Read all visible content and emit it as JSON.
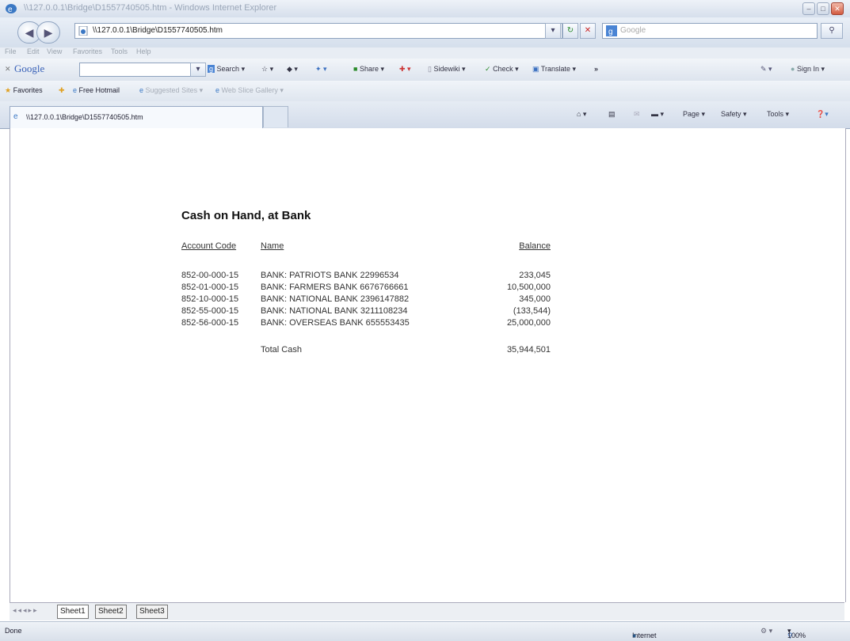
{
  "window": {
    "title": "\\\\127.0.0.1\\Bridge\\D1557740505.htm - Windows Internet Explorer"
  },
  "address": {
    "url": "\\\\127.0.0.1\\Bridge\\D1557740505.htm",
    "search_placeholder": "Google"
  },
  "menu": [
    "File",
    "Edit",
    "View",
    "Favorites",
    "Tools",
    "Help"
  ],
  "google_toolbar": {
    "logo": "Google",
    "search": "Search",
    "share": "Share",
    "sidewiki": "Sidewiki",
    "check": "Check",
    "translate": "Translate",
    "more": "»",
    "signin": "Sign In"
  },
  "favorites": {
    "label": "Favorites",
    "hotmail": "Free Hotmail",
    "suggested": "Suggested Sites",
    "web_slice": "Web Slice Gallery"
  },
  "tab": {
    "label": "\\\\127.0.0.1\\Bridge\\D1557740505.htm"
  },
  "commands": {
    "page": "Page",
    "safety": "Safety",
    "tools": "Tools"
  },
  "report": {
    "title": "Cash on Hand, at Bank",
    "headers": {
      "code": "Account Code",
      "name": "Name",
      "balance": "Balance"
    },
    "rows": [
      {
        "code": "852-00-000-15",
        "name": "BANK: PATRIOTS BANK 22996534",
        "balance": "233,045"
      },
      {
        "code": "852-01-000-15",
        "name": "BANK: FARMERS BANK 6676766661",
        "balance": "10,500,000"
      },
      {
        "code": "852-10-000-15",
        "name": "BANK: NATIONAL BANK 2396147882",
        "balance": "345,000"
      },
      {
        "code": "852-55-000-15",
        "name": "BANK: NATIONAL BANK 3211108234",
        "balance": "(133,544)"
      },
      {
        "code": "852-56-000-15",
        "name": "BANK: OVERSEAS BANK 655553435",
        "balance": "25,000,000"
      }
    ],
    "total_label": "Total Cash",
    "total_value": "35,944,501"
  },
  "sheets": [
    "Sheet1",
    "Sheet2",
    "Sheet3"
  ],
  "status": {
    "left": "Done",
    "zone": "Internet",
    "zoom": "100%"
  }
}
